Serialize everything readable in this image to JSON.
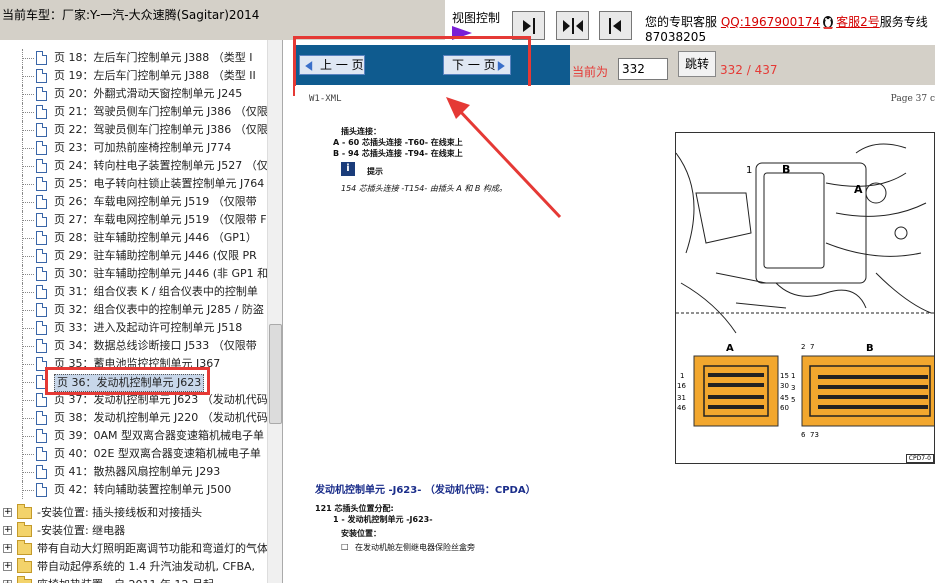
{
  "header": {
    "car_label": "当前车型：厂家:Y-一汽-大众速腾(Sagitar)2014",
    "view_control": "视图控制",
    "service_prefix": "您的专职客服",
    "qq": "QQ:1967900174",
    "kefu2": "客服2号",
    "service_suffix": "服务专线",
    "phone": "87038205"
  },
  "sidebar": {
    "items": [
      {
        "label": "页 18：左后车门控制单元 J388 （类型 I"
      },
      {
        "label": "页 19：左后车门控制单元 J388 （类型 II"
      },
      {
        "label": "页 20：外翻式滑动天窗控制单元 J245"
      },
      {
        "label": "页 21：驾驶员侧车门控制单元 J386 （仅限"
      },
      {
        "label": "页 22：驾驶员侧车门控制单元 J386 （仅限"
      },
      {
        "label": "页 23：可加热前座椅控制单元 J774"
      },
      {
        "label": "页 24：转向柱电子装置控制单元 J527 （仅"
      },
      {
        "label": "页 25：电子转向柱锁止装置控制单元 J764"
      },
      {
        "label": "页 26：车载电网控制单元 J519 （仅限带"
      },
      {
        "label": "页 27：车载电网控制单元 J519 （仅限带 F"
      },
      {
        "label": "页 28：驻车辅助控制单元 J446 （GP1）"
      },
      {
        "label": "页 29：驻车辅助控制单元 J446 (仅限 PR"
      },
      {
        "label": "页 30：驻车辅助控制单元 J446 (非 GP1 和"
      },
      {
        "label": "页 31：组合仪表 K / 组合仪表中的控制单"
      },
      {
        "label": "页 32：组合仪表中的控制单元 J285 / 防盗"
      },
      {
        "label": "页 33：进入及起动许可控制单元 J518"
      },
      {
        "label": "页 34：数据总线诊断接口 J533 （仅限带"
      },
      {
        "label": "页 35：蓄电池监控控制单元 J367"
      },
      {
        "label": "页 36：发动机控制单元 J623"
      },
      {
        "label": "页 37：发动机控制单元 J623 （发动机代码"
      },
      {
        "label": "页 38：发动机控制单元 J220 （发动机代码"
      },
      {
        "label": "页 39：0AM 型双离合器变速箱机械电子单"
      },
      {
        "label": "页 40：02E 型双离合器变速箱机械电子单"
      },
      {
        "label": "页 41：散热器风扇控制单元 J293"
      },
      {
        "label": "页 42：转向辅助装置控制单元 J500"
      }
    ],
    "folders": [
      {
        "label": "-安装位置: 插头接线板和对接插头"
      },
      {
        "label": "-安装位置: 继电器"
      },
      {
        "label": "带有自动大灯照明距离调节功能和弯道灯的气体"
      },
      {
        "label": "带自动起停系统的 1.4 升汽油发动机, CFBA,"
      },
      {
        "label": "座椅加热装置，自 2011 年 12 月起"
      }
    ]
  },
  "toolbar": {
    "prev": "上 一 页",
    "next": "下 一 页",
    "current_label": "当前为",
    "page_value": "332",
    "jump": "跳转",
    "total": "332 / 437"
  },
  "document": {
    "code": "W1-XML",
    "page": "Page 37 c",
    "connector_heading": "插头连接：",
    "line_a": "A - 60 芯插头连接 -T60- 在线束上",
    "line_b": "B - 94 芯插头连接 -T94- 在线束上",
    "note_label": "提示",
    "note_text": "154 芯插头连接 -T154- 由插头 A 和 B 构成。",
    "section_title": "发动机控制单元 -J623- （发动机代码：CPDA）",
    "pin_heading": "121 芯插头位置分配:",
    "item1": "1 - 发动机控制单元 -J623-",
    "install_label": "安装位置：",
    "install_text": "在发动机舱左侧继电器保险丝盒旁",
    "fig_ref": "CPD7-0",
    "fig_labels": {
      "a_top": "A",
      "b_top": "B",
      "one": "1",
      "conn_a": "A",
      "conn_b": "B",
      "a_pins": [
        "1",
        "16",
        "31",
        "46"
      ],
      "a_pins_right": [
        "15",
        "30",
        "45",
        "60"
      ],
      "b_pins_top": [
        "2",
        "7"
      ],
      "b_pins_left": [
        "1",
        "3",
        "5"
      ],
      "b_pins_bottom": [
        "6",
        "73"
      ]
    }
  },
  "colors": {
    "toolbar_blue": "#0f5b8f",
    "highlight_red": "#e53935",
    "connector_orange": "#f2a72e",
    "arrow_purple": "#7a1fd6"
  }
}
